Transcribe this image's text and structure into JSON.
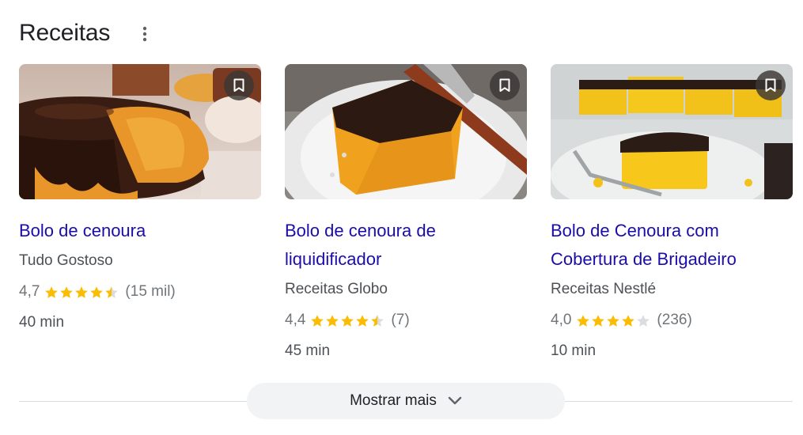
{
  "section": {
    "title": "Receitas"
  },
  "show_more": {
    "label": "Mostrar mais"
  },
  "colors": {
    "link": "#1a0dab",
    "star": "#fbbc04",
    "star_empty": "#dadce0",
    "muted": "#70757a"
  },
  "recipes": [
    {
      "title": "Bolo de cenoura",
      "source": "Tudo Gostoso",
      "rating": "4,7",
      "rating_value": 4.7,
      "count": "(15 mil)",
      "time": "40 min",
      "image": "bundt carrot cake with chocolate glaze"
    },
    {
      "title": "Bolo de cenoura de liquidificador",
      "source": "Receitas Globo",
      "rating": "4,4",
      "rating_value": 4.4,
      "count": "(7)",
      "time": "45 min",
      "image": "square carrot cake slice with chocolate topping on plate"
    },
    {
      "title": "Bolo de Cenoura com Cobertura de Brigadeiro",
      "source": "Receitas Nestlé",
      "rating": "4,0",
      "rating_value": 4.0,
      "count": "(236)",
      "time": "10 min",
      "image": "carrot cake squares with brigadeiro sprinkles"
    }
  ]
}
